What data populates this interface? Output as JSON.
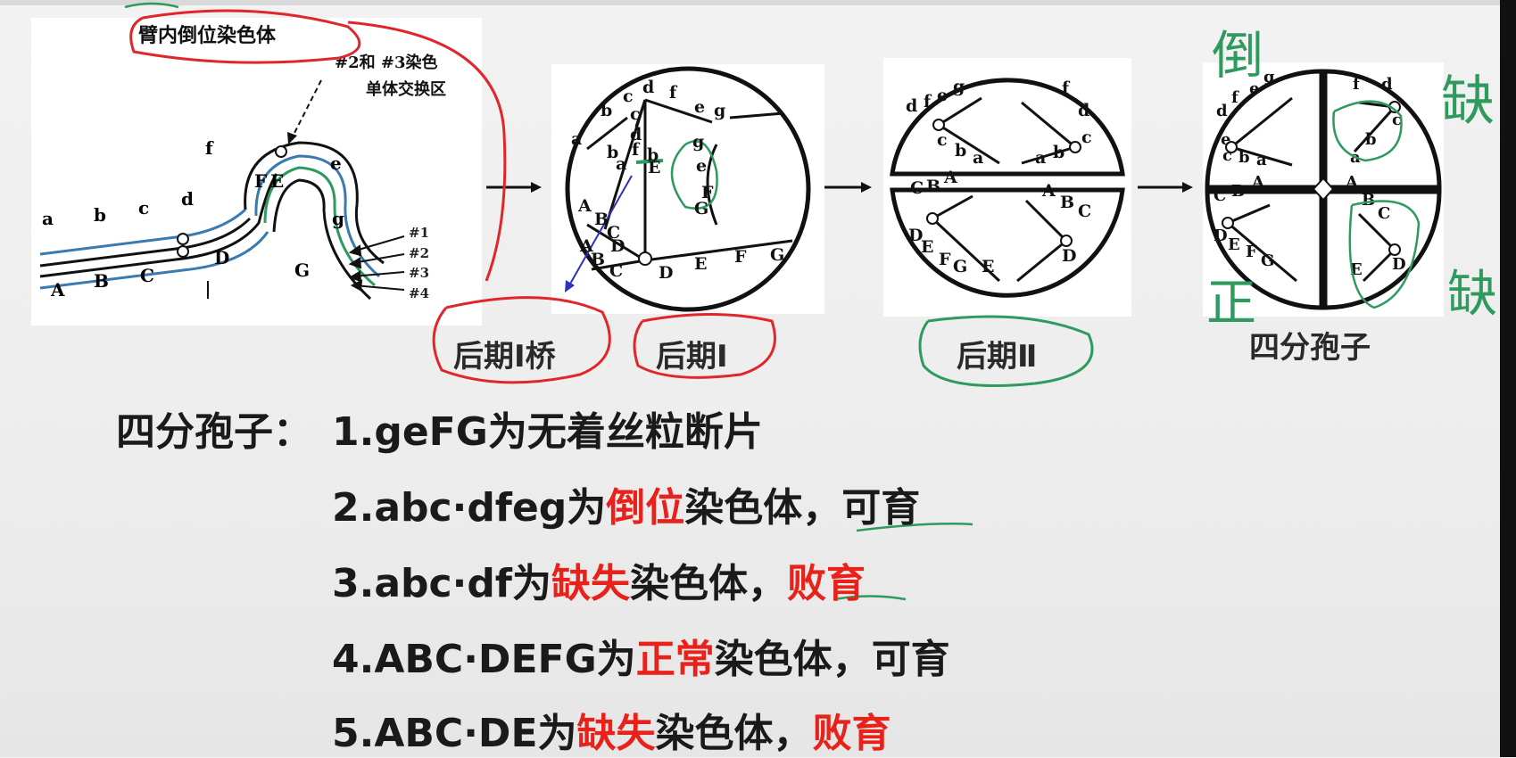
{
  "diagram": {
    "panel1_title": "臂内倒位染色体",
    "exchange_label_line1": "#2和 #3染色",
    "exchange_label_line2": "单体交换区",
    "strand_labels": [
      "#1",
      "#2",
      "#3",
      "#4"
    ],
    "lower_genes": [
      "A",
      "B",
      "C",
      "D",
      "E",
      "F",
      "G"
    ],
    "upper_genes": [
      "a",
      "b",
      "c",
      "d",
      "e",
      "f",
      "g"
    ]
  },
  "stages": {
    "bridge": "后期Ⅰ桥",
    "anaphase1": "后期Ⅰ",
    "anaphase2": "后期Ⅱ",
    "tetrad": "四分孢子"
  },
  "outcomes": {
    "heading": "四分孢子：",
    "items": [
      {
        "prefix": "1.geFG为无着丝粒断片",
        "highlight": "",
        "middle": "",
        "fertility": ""
      },
      {
        "prefix": "2.abc·dfeg为",
        "highlight": "倒位",
        "middle": "染色体，",
        "fertility": "可育"
      },
      {
        "prefix": "3.abc·df为",
        "highlight": "缺失",
        "middle": "染色体，",
        "fertility": "败育"
      },
      {
        "prefix": "4.ABC·DEFG为",
        "highlight": "正常",
        "middle": "染色体，",
        "fertility": "可育"
      },
      {
        "prefix": "5.ABC·DE为",
        "highlight": "缺失",
        "middle": "染色体，",
        "fertility": "败育"
      }
    ]
  },
  "handwriting": {
    "inversion": "倒",
    "deletion_top": "缺",
    "deletion_bottom": "缺",
    "normal": "正"
  },
  "colors": {
    "red_text": "#e8221a",
    "red_ink": "#e0262a",
    "green_ink": "#2e9a5e",
    "blue_strand": "#3a7ab0"
  }
}
